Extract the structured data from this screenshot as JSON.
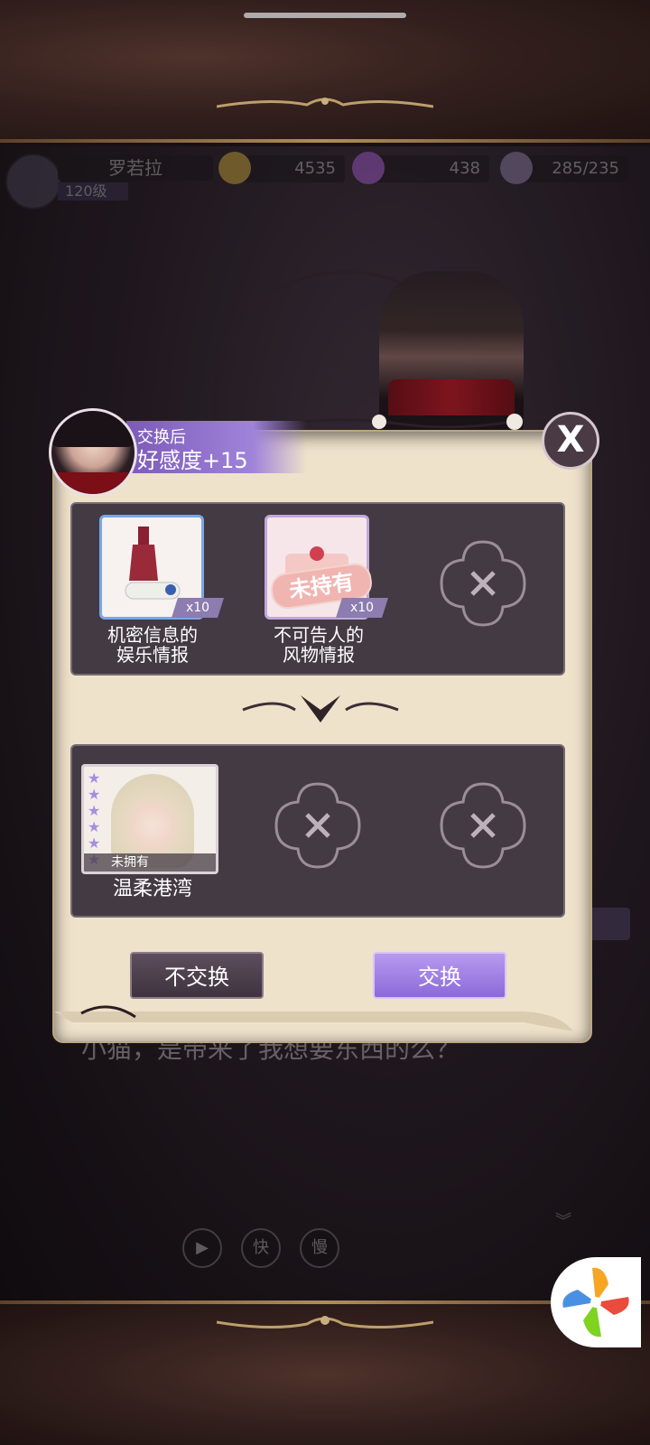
{
  "hud": {
    "player_name": "罗若拉",
    "player_level": "120级",
    "gold": "4535",
    "diamonds": "438",
    "stamina": "285/235"
  },
  "modal": {
    "banner_subtitle": "交换后",
    "banner_title": "好感度+15",
    "close_label": "X",
    "give_items": [
      {
        "label_line1": "机密信息的",
        "label_line2": "娱乐情报",
        "qty": "x10",
        "stamp": ""
      },
      {
        "label_line1": "不可告人的",
        "label_line2": "风物情报",
        "qty": "x10",
        "stamp": "未持有"
      }
    ],
    "receive_items": [
      {
        "label": "温柔港湾",
        "status": "未拥有",
        "stars": 6
      }
    ],
    "cancel_label": "不交换",
    "confirm_label": "交换"
  },
  "dialog": {
    "line": "小猫，是带来了我想要东西的么？"
  },
  "controls": {
    "play_label": "",
    "fast_label": "快",
    "slow_label": "慢"
  },
  "colors": {
    "parchment": "#efe2ca",
    "panel": "#433a43",
    "accent_purple": "#9f83d9",
    "coat_red": "#7b0e16"
  }
}
